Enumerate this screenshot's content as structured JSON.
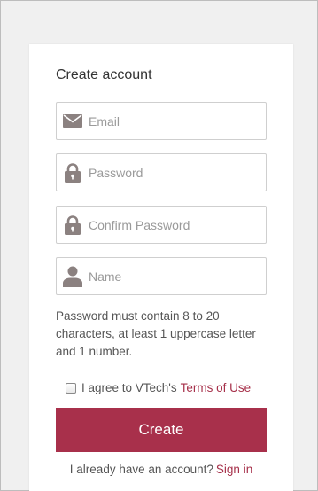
{
  "form": {
    "title": "Create account",
    "fields": {
      "email": {
        "placeholder": "Email",
        "value": "",
        "icon": "envelope-icon"
      },
      "password": {
        "placeholder": "Password",
        "value": "",
        "icon": "lock-icon"
      },
      "confirm_password": {
        "placeholder": "Confirm Password",
        "value": "",
        "icon": "lock-icon"
      },
      "name": {
        "placeholder": "Name",
        "value": "",
        "icon": "user-icon"
      }
    },
    "password_hint": "Password must contain 8 to 20 characters, at least 1 uppercase letter and 1 number.",
    "agree": {
      "text": "I agree to VTech's",
      "link": "Terms of Use",
      "checked": false
    },
    "create_label": "Create",
    "signin": {
      "text": "I already have an account?",
      "link": "Sign in"
    }
  },
  "colors": {
    "accent": "#a8304b",
    "icon": "#8b8180",
    "border": "#cfcfcf",
    "background": "#f0f0f0"
  }
}
